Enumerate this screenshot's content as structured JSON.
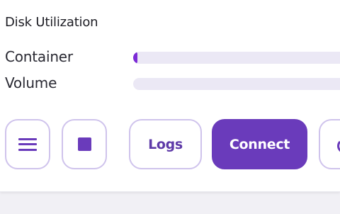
{
  "disk_utilization": {
    "title": "Disk Utilization",
    "rows": [
      {
        "label": "Container",
        "usage_fraction": 0.02
      },
      {
        "label": "Volume",
        "usage_fraction": 0.0
      }
    ]
  },
  "actions": {
    "menu_icon": "hamburger-menu-icon",
    "stop_icon": "stop-square-icon",
    "logs_label": "Logs",
    "connect_label": "Connect",
    "more_icon": "partial-icon"
  },
  "colors": {
    "accent": "#6a3bbb",
    "bar_fill": "#7c2bd6",
    "bar_track": "#ebe8f5",
    "button_border": "#cfc3ec"
  }
}
